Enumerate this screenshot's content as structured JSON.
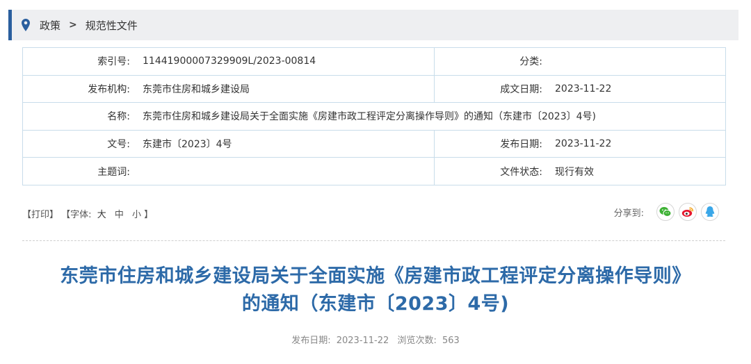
{
  "breadcrumb": {
    "items": [
      "政策",
      "规范性文件"
    ],
    "separator": ">"
  },
  "meta": {
    "index_label": "索引号:",
    "index_value": "11441900007329909L/2023-00814",
    "category_label": "分类:",
    "category_value": "",
    "issuer_label": "发布机构:",
    "issuer_value": "东莞市住房和城乡建设局",
    "written_date_label": "成文日期:",
    "written_date_value": "2023-11-22",
    "name_label": "名称:",
    "name_value": "东莞市住房和城乡建设局关于全面实施《房建市政工程评定分离操作导则》的通知（东建市〔2023〕4号)",
    "doc_no_label": "文号:",
    "doc_no_value": "东建市〔2023〕4号",
    "publish_date_label": "发布日期:",
    "publish_date_value": "2023-11-22",
    "subject_label": "主题词:",
    "subject_value": "",
    "status_label": "文件状态:",
    "status_value": "现行有效"
  },
  "tools": {
    "print": "【打印】",
    "font_prefix": "【字体:",
    "font_large": "大",
    "font_medium": "中",
    "font_small": "小",
    "font_suffix": "】"
  },
  "share": {
    "label": "分享到:",
    "icons": [
      "wechat-icon",
      "weibo-icon",
      "qq-icon"
    ],
    "colors": {
      "wechat": "#3eb135",
      "weibo": "#e6162d",
      "qq": "#3aa7e8"
    }
  },
  "article": {
    "title_line1": "东莞市住房和城乡建设局关于全面实施《房建市政工程评定分离操作导则》",
    "title_line2": "的通知（东建市〔2023〕4号)",
    "publish_date_label": "发布日期:",
    "publish_date": "2023-11-22",
    "views_label": "浏览次数:",
    "views": "563"
  },
  "colors": {
    "accent": "#2a5f9e",
    "title": "#2d6aa8",
    "table_border": "#c8dcea"
  }
}
